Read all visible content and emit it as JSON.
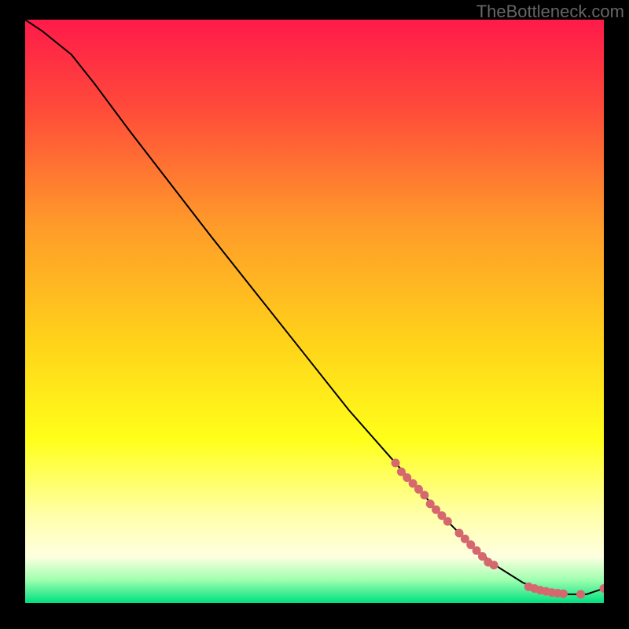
{
  "watermark": "TheBottleneck.com",
  "chart_data": {
    "type": "line",
    "title": "",
    "xlabel": "",
    "ylabel": "",
    "xlim": [
      0,
      100
    ],
    "ylim": [
      0,
      100
    ],
    "background_gradient": {
      "stops": [
        {
          "offset": 0.0,
          "color": "#ff1a4a"
        },
        {
          "offset": 0.15,
          "color": "#ff4a3a"
        },
        {
          "offset": 0.35,
          "color": "#ff9a2a"
        },
        {
          "offset": 0.55,
          "color": "#ffd21a"
        },
        {
          "offset": 0.72,
          "color": "#ffff1a"
        },
        {
          "offset": 0.85,
          "color": "#ffffaa"
        },
        {
          "offset": 0.92,
          "color": "#ffffe0"
        },
        {
          "offset": 0.96,
          "color": "#a0ffb0"
        },
        {
          "offset": 1.0,
          "color": "#00e080"
        }
      ]
    },
    "series": [
      {
        "name": "bottleneck-curve",
        "type": "line",
        "color": "#000000",
        "x": [
          0,
          3,
          8,
          12,
          18,
          25,
          32,
          40,
          48,
          56,
          64,
          72,
          78,
          82,
          86,
          90,
          94,
          97,
          100
        ],
        "y": [
          100,
          98,
          94,
          89,
          81,
          72,
          63,
          53,
          43,
          33,
          24,
          15,
          9,
          6,
          3.5,
          2,
          1.5,
          1.5,
          2.5
        ]
      },
      {
        "name": "data-points",
        "type": "scatter",
        "color": "#d4686e",
        "x": [
          64,
          65,
          66,
          67,
          68,
          69,
          70,
          71,
          72,
          73,
          75,
          76,
          77,
          78,
          79,
          80,
          81,
          87,
          88,
          89,
          90,
          91,
          92,
          93,
          96,
          100
        ],
        "y": [
          24,
          22.5,
          21.5,
          20.5,
          19.5,
          18.5,
          17,
          16,
          15,
          14,
          12,
          11,
          10,
          9,
          8,
          7,
          6.5,
          2.8,
          2.5,
          2.2,
          2,
          1.8,
          1.7,
          1.6,
          1.5,
          2.5
        ]
      }
    ]
  }
}
